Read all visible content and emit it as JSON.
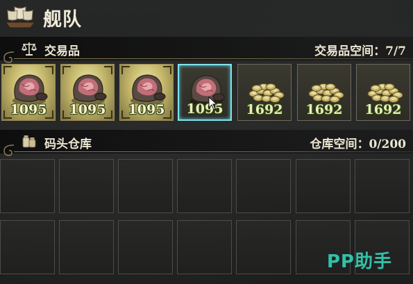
{
  "header": {
    "title": "舰队",
    "icon": "ship-icon"
  },
  "trade_section": {
    "label": "交易品",
    "icon": "scales-icon",
    "capacity_label": "交易品空间：",
    "capacity_value": "7/7",
    "items": [
      {
        "qty": "1095",
        "kind": "meat-pile-icon",
        "rarity": "rare",
        "selected": false
      },
      {
        "qty": "1095",
        "kind": "meat-pile-icon",
        "rarity": "rare",
        "selected": false
      },
      {
        "qty": "1095",
        "kind": "meat-pile-icon",
        "rarity": "rare",
        "selected": false
      },
      {
        "qty": "1095",
        "kind": "meat-pile-icon",
        "rarity": "common",
        "selected": true
      },
      {
        "qty": "1692",
        "kind": "coin-pile-icon",
        "rarity": "common",
        "selected": false
      },
      {
        "qty": "1692",
        "kind": "coin-pile-icon",
        "rarity": "common",
        "selected": false
      },
      {
        "qty": "1692",
        "kind": "coin-pile-icon",
        "rarity": "common",
        "selected": false
      }
    ]
  },
  "warehouse_section": {
    "label": "码头仓库",
    "icon": "jars-icon",
    "capacity_label": "仓库空间：",
    "capacity_value": "0/200"
  },
  "watermark": "PP助手",
  "colors": {
    "selected_border": "#7ee3ee",
    "rare_slot": "#c5b86c",
    "watermark": "#33c0a8"
  }
}
